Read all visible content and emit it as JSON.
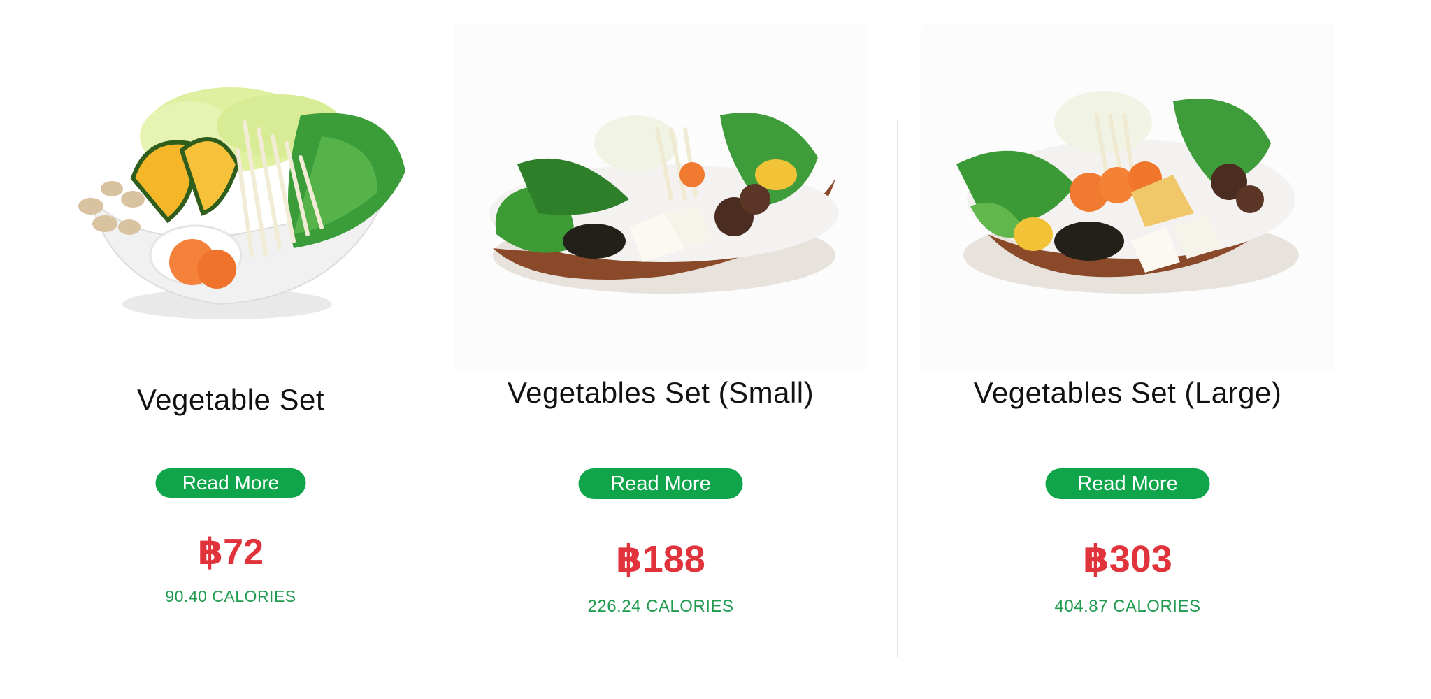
{
  "products": [
    {
      "name": "Vegetable Set",
      "button_label": "Read More",
      "price": "฿72",
      "calories": "90.40 CALORIES",
      "image_icon": "vegetable-bowl-image"
    },
    {
      "name": "Vegetables Set (Small)",
      "button_label": "Read More",
      "price": "฿188",
      "calories": "226.24 CALORIES",
      "image_icon": "vegetable-platter-image"
    },
    {
      "name": "Vegetables Set (Large)",
      "button_label": "Read More",
      "price": "฿303",
      "calories": "404.87 CALORIES",
      "image_icon": "vegetable-platter-image"
    }
  ],
  "colors": {
    "button": "#10a54b",
    "price": "#e0333c",
    "calories": "#1f9a4f",
    "title": "#111111"
  }
}
